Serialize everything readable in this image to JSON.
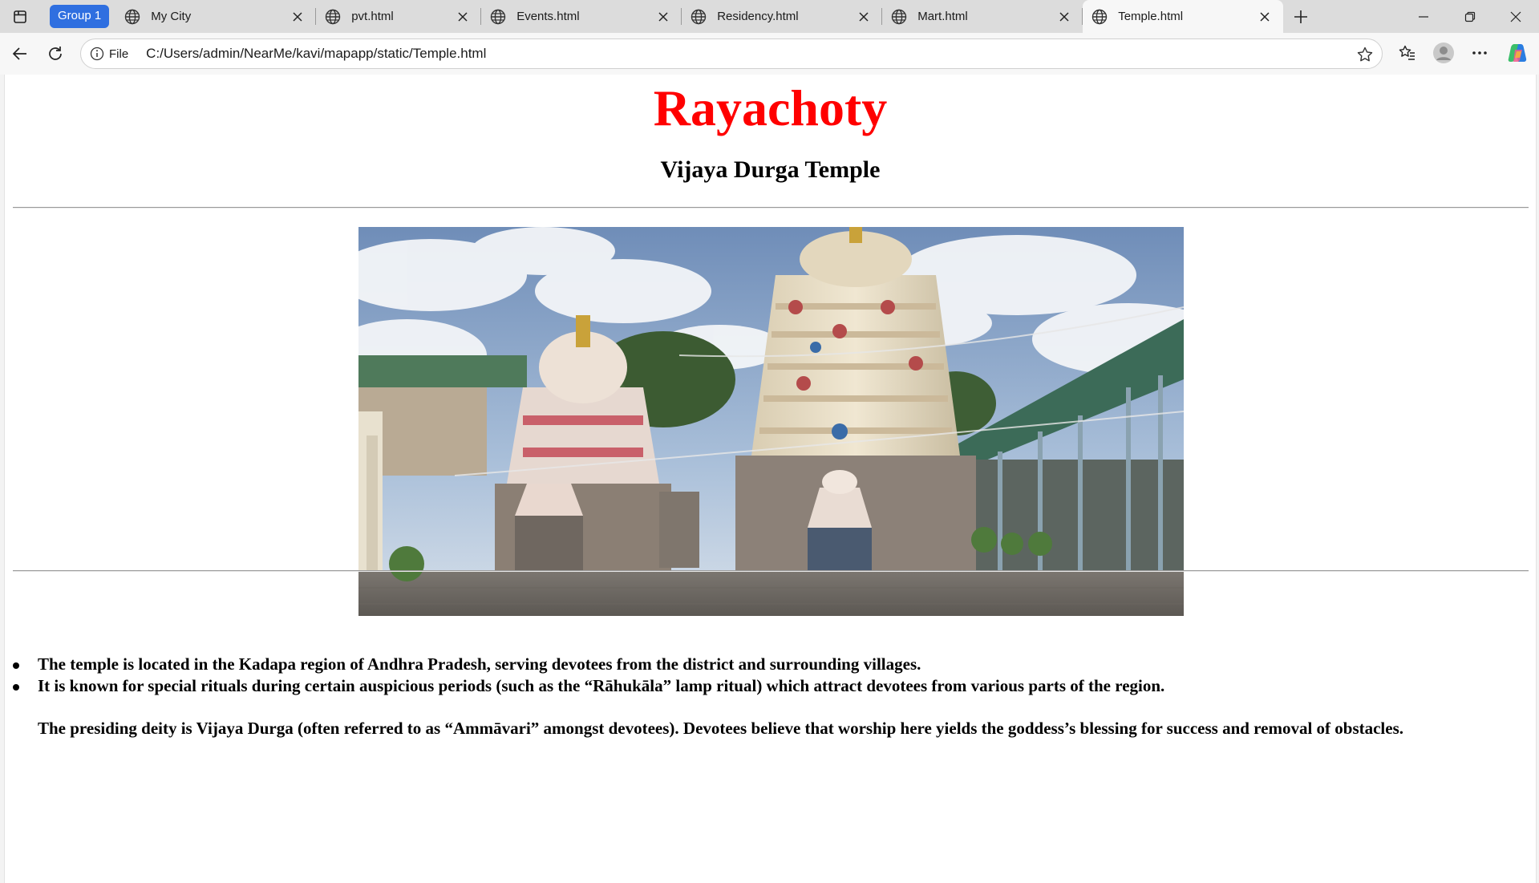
{
  "browser": {
    "tab_group_label": "Group 1",
    "tabs": [
      {
        "title": "My City",
        "active": false
      },
      {
        "title": "pvt.html",
        "active": false
      },
      {
        "title": "Events.html",
        "active": false
      },
      {
        "title": "Residency.html",
        "active": false
      },
      {
        "title": "Mart.html",
        "active": false
      },
      {
        "title": "Temple.html",
        "active": true
      }
    ],
    "address_bar": {
      "scheme_label": "File",
      "url": "C:/Users/admin/NearMe/kavi/mapapp/static/Temple.html"
    }
  },
  "page": {
    "heading": "Rayachoty",
    "subheading": "Vijaya Durga Temple",
    "facts": [
      "The temple is located in the Kadapa region of Andhra Pradesh, serving devotees from the district and surrounding villages.",
      "It is known for special rituals during certain auspicious periods (such as the “Rāhukāla” lamp ritual) which attract devotees from various parts of the region.",
      "The presiding deity is Vijaya Durga (often referred to as “Ammāvari” amongst devotees). Devotees believe that worship here yields the goddess’s blessing for success and removal of obstacles."
    ]
  },
  "colors": {
    "heading": "#ff0000",
    "tab_group": "#2f6fe0"
  }
}
